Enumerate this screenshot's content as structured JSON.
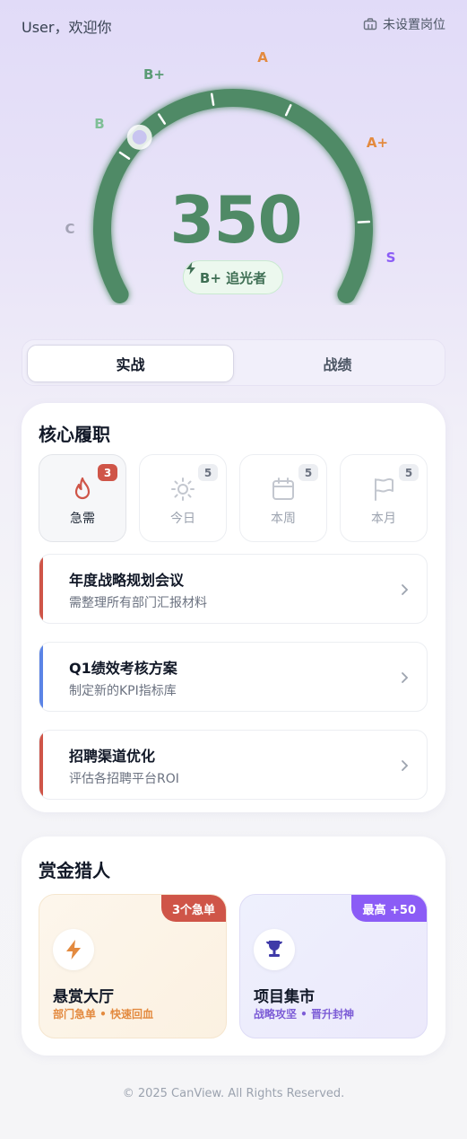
{
  "header": {
    "greeting": "User，欢迎你",
    "post_label": "未设置岗位"
  },
  "gauge": {
    "score": "350",
    "rank_label": "B+ 追光者",
    "progress_fraction": 0.31,
    "colors": {
      "track": "#4f8a66",
      "handle": "#c8c4f0"
    },
    "grades": [
      {
        "label": "C",
        "color": "#a3a3b5"
      },
      {
        "label": "B",
        "color": "#7fbf97"
      },
      {
        "label": "B+",
        "color": "#5a9b75"
      },
      {
        "label": "A",
        "color": "#e38a3f"
      },
      {
        "label": "A+",
        "color": "#e38a3f"
      },
      {
        "label": "S",
        "color": "#8b5cf6"
      }
    ]
  },
  "tabs": [
    {
      "label": "实战",
      "active": true
    },
    {
      "label": "战绩",
      "active": false
    }
  ],
  "core": {
    "title": "核心履职",
    "filters": [
      {
        "label": "急需",
        "count": "3",
        "icon": "flame-icon",
        "active": true
      },
      {
        "label": "今日",
        "count": "5",
        "icon": "sun-icon",
        "active": false
      },
      {
        "label": "本周",
        "count": "5",
        "icon": "calendar-icon",
        "active": false
      },
      {
        "label": "本月",
        "count": "5",
        "icon": "flag-icon",
        "active": false
      }
    ],
    "tasks": [
      {
        "title": "年度战略规划会议",
        "subtitle": "需整理所有部门汇报材料",
        "color": "#cf5548"
      },
      {
        "title": "Q1绩效考核方案",
        "subtitle": "制定新的KPI指标库",
        "color": "#5b84e6"
      },
      {
        "title": "招聘渠道优化",
        "subtitle": "评估各招聘平台ROI",
        "color": "#cf5548"
      }
    ]
  },
  "bounty": {
    "title": "赏金猎人",
    "cards": [
      {
        "title": "悬赏大厅",
        "subtitle": "部门急单 • 快速回血",
        "tag": "3个急单",
        "icon": "lightning-icon",
        "tag_color": "#cf5548",
        "sub_color": "#e38a3f"
      },
      {
        "title": "项目集市",
        "subtitle": "战略攻坚 • 晋升封神",
        "tag": "最高 +50",
        "icon": "trophy-icon",
        "tag_color": "#8b5cf6",
        "sub_color": "#7c5cd6"
      }
    ]
  },
  "footer": {
    "copyright": "© 2025 CanView. All Rights Reserved."
  }
}
